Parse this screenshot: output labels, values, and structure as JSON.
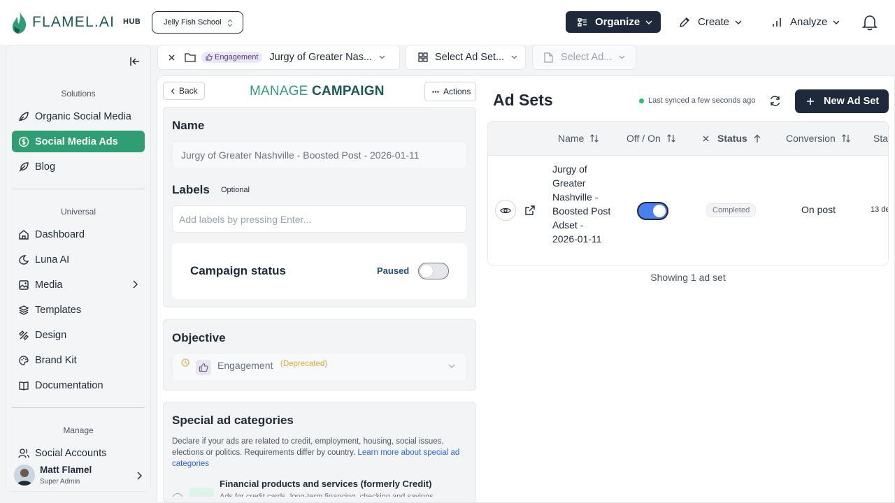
{
  "app": {
    "logo_text": "FLAMEL.AI",
    "hub_label": "HUB",
    "workspace": "Jelly Fish School",
    "colors": {
      "brand_green": "#2f9e74",
      "brand_dark": "#1a5a54",
      "navy": "#1e293b",
      "toggle_blue": "#4a7ff0"
    }
  },
  "topnav": {
    "organize": "Organize",
    "create": "Create",
    "analyze": "Analyze",
    "icons": [
      "organize-icon",
      "pencil-icon",
      "bar-chart-icon",
      "bell-icon"
    ]
  },
  "sidebar": {
    "solutions_title": "Solutions",
    "solutions": [
      {
        "label": "Organic Social Media",
        "icon": "leaf-icon"
      },
      {
        "label": "Social Media Ads",
        "icon": "dollar-circle-icon",
        "active": true
      },
      {
        "label": "Blog",
        "icon": "feather-icon"
      }
    ],
    "universal_title": "Universal",
    "universal": [
      {
        "label": "Dashboard",
        "icon": "home-icon"
      },
      {
        "label": "Luna AI",
        "icon": "moon-icon"
      },
      {
        "label": "Media",
        "icon": "image-icon",
        "has_submenu": true
      },
      {
        "label": "Templates",
        "icon": "templates-icon"
      },
      {
        "label": "Design",
        "icon": "design-icon"
      },
      {
        "label": "Brand Kit",
        "icon": "palette-icon"
      },
      {
        "label": "Documentation",
        "icon": "book-icon"
      }
    ],
    "manage_title": "Manage",
    "manage": [
      {
        "label": "Social Accounts",
        "icon": "users-icon"
      }
    ],
    "user": {
      "name": "Matt Flamel",
      "role": "Super Admin"
    }
  },
  "breadcrumb": {
    "objective_pill": "Engagement",
    "campaign": "Jurgy of Greater Nas...",
    "adset": "Select Ad Set...",
    "ad": "Select Ad..."
  },
  "campaign": {
    "back": "Back",
    "title_part1": "MANAGE",
    "title_part2": "CAMPAIGN",
    "actions": "Actions",
    "name_label": "Name",
    "name_value": "Jurgy of Greater Nashville - Boosted Post - 2026-01-11",
    "labels_label": "Labels",
    "labels_optional": "Optional",
    "labels_placeholder": "Add labels by pressing Enter...",
    "status_label": "Campaign status",
    "status_value": "Paused",
    "status_on": false,
    "objective_label": "Objective",
    "objective_value": "Engagement",
    "objective_note": "(Deprecated)",
    "special_title": "Special ad categories",
    "special_desc": "Declare if your ads are related to credit, employment, housing, social issues, elections or politics. Requirements differ by country.",
    "special_link": "Learn more about special ad categories",
    "fin_title": "Financial products and services (formerly Credit)",
    "fin_desc": "Ads for credit cards, long-term financing, checking and savings"
  },
  "adsets": {
    "title": "Ad Sets",
    "sync_text": "Last synced a few seconds ago",
    "new_button": "New Ad Set",
    "columns": {
      "name": "Name",
      "offon": "Off / On",
      "status": "Status",
      "conversion": "Conversion",
      "start": "Sta"
    },
    "rows": [
      {
        "name": "Jurgy of Greater Nashville - Boosted Post Adset - 2026-01-11",
        "enabled": true,
        "status": "Completed",
        "conversion": "On post",
        "start": "13 de"
      }
    ],
    "showing": "Showing 1 ad set"
  }
}
